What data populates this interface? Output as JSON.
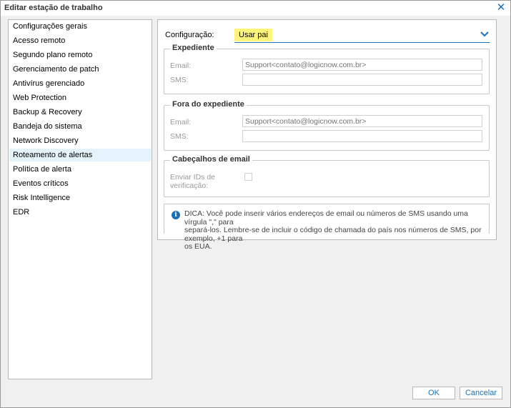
{
  "window": {
    "title": "Editar estação de trabalho",
    "close_icon": "close-icon"
  },
  "sidebar": {
    "items": [
      {
        "label": "Configurações gerais"
      },
      {
        "label": "Acesso remoto"
      },
      {
        "label": "Segundo plano remoto"
      },
      {
        "label": "Gerenciamento de patch"
      },
      {
        "label": "Antivírus gerenciado"
      },
      {
        "label": "Web Protection"
      },
      {
        "label": "Backup & Recovery"
      },
      {
        "label": "Bandeja do sistema"
      },
      {
        "label": "Network Discovery"
      },
      {
        "label": "Roteamento de alertas",
        "selected": true
      },
      {
        "label": "Política de alerta"
      },
      {
        "label": "Eventos críticos"
      },
      {
        "label": "Risk Intelligence"
      },
      {
        "label": "EDR"
      }
    ]
  },
  "config": {
    "label": "Configuração:",
    "value": "Usar pai",
    "highlight": "#fff57a"
  },
  "expediente": {
    "title": "Expediente",
    "email_label": "Email:",
    "email_placeholder": "Support<contato@logicnow.com.br>",
    "sms_label": "SMS:",
    "sms_value": ""
  },
  "fora": {
    "title": "Fora do expediente",
    "email_label": "Email:",
    "email_placeholder": "Support<contato@logicnow.com.br>",
    "sms_label": "SMS:",
    "sms_value": ""
  },
  "headers": {
    "title": "Cabeçalhos de email",
    "send_ids_label_1": "Enviar IDs de",
    "send_ids_label_2": "verificação:",
    "checked": false
  },
  "tip": {
    "icon": "info-icon",
    "line1": "DICA: Você pode inserir vários endereços de email ou números de SMS usando uma vírgula \",\" para",
    "line2": "separá-los. Lembre-se de incluir o código de chamada do país nos números de SMS, por exemplo, +1 para",
    "line3": "os EUA."
  },
  "buttons": {
    "ok": "OK",
    "cancel": "Cancelar"
  },
  "colors": {
    "accent": "#1a6fb5",
    "selected_bg": "#e5f3fb"
  }
}
